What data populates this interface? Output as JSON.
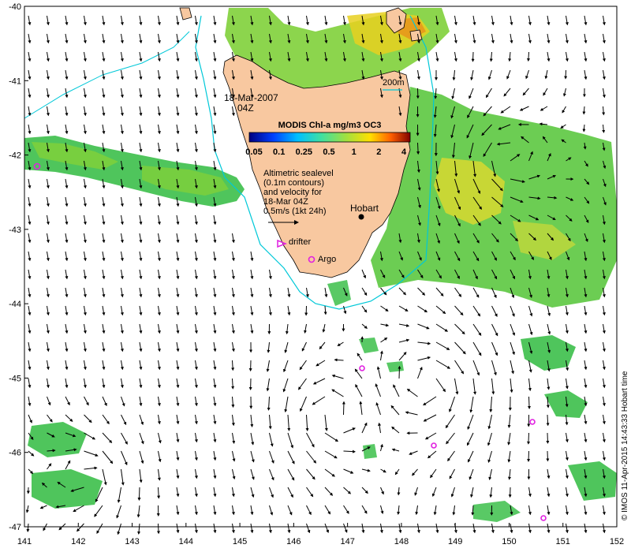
{
  "map": {
    "lon_ticks": [
      "141",
      "142",
      "143",
      "144",
      "145",
      "146",
      "147",
      "148",
      "149",
      "150",
      "151",
      "152"
    ],
    "lat_ticks": [
      "-40",
      "-41",
      "-42",
      "-43",
      "-44",
      "-45",
      "-46",
      "-47"
    ],
    "lon_range": [
      141,
      152
    ],
    "lat_range": [
      -47,
      -40
    ],
    "date_line1": "18-Mar-2007",
    "date_line2": "04Z",
    "isobath_label": "200m",
    "colorbar_title": "MODIS Chl-a mg/m3 OC3",
    "colorbar_ticks": [
      "0.05",
      "0.1",
      "0.25",
      "0.5",
      "1",
      "2",
      "4"
    ],
    "description_lines": [
      "Altimetric sealevel",
      "(0.1m contours)",
      "and velocity for",
      "18-Mar 04Z",
      "0.5m/s (1kt 24h)"
    ],
    "hobart_label": "Hobart",
    "drifter_label": "drifter",
    "argo_label": "Argo",
    "credit": "© IMOS 11-Apr-2015 14:43:33 Hobart time",
    "colors": {
      "land": "#f8c8a0",
      "chl_low": "#1eb45a",
      "chl_mid": "#7fd03a",
      "chl_high": "#e8d020",
      "isobath": "#00c8d8",
      "marker": "#e020e0",
      "arrow": "#000000"
    }
  }
}
